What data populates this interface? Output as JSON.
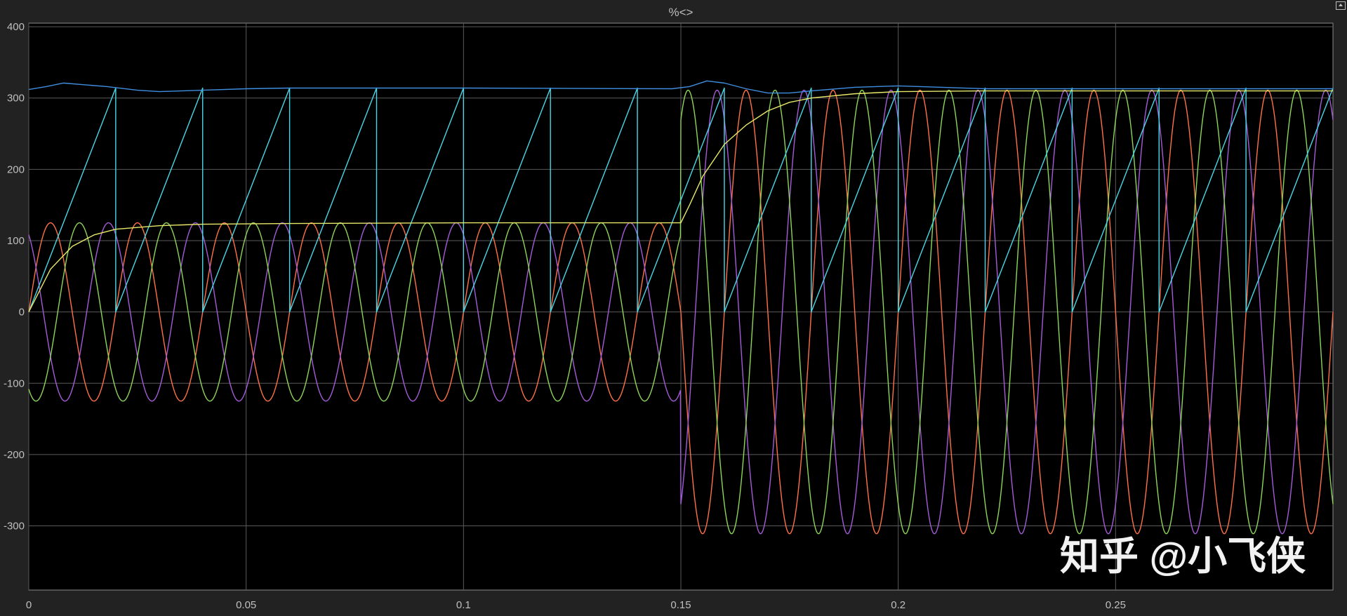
{
  "window": {
    "title": "%<>"
  },
  "watermark": "知乎 @小飞侠",
  "icons": {
    "undock": "undock-icon"
  },
  "chart_data": {
    "type": "line",
    "title": "%<>",
    "xlabel": "",
    "ylabel": "",
    "xlim": [
      0,
      0.3
    ],
    "ylim": [
      -390,
      405
    ],
    "grid": true,
    "background": "#000000",
    "x_ticks": [
      0,
      0.05,
      0.1,
      0.15,
      0.2,
      0.25
    ],
    "x_tick_labels": [
      "0",
      "0.05",
      "0.1",
      "0.15",
      "0.2",
      "0.25"
    ],
    "y_ticks": [
      400,
      300,
      200,
      100,
      0,
      -100,
      -200,
      -300
    ],
    "y_tick_labels": [
      "400",
      "300",
      "200",
      "100",
      "0",
      "-100",
      "-200",
      "-300"
    ],
    "series": [
      {
        "color": "#ff7148",
        "type": "sine",
        "frequency_hz": 50,
        "amplitude_segments": [
          {
            "x_start": 0,
            "x_end": 0.15,
            "amplitude": 125
          },
          {
            "x_start": 0.15,
            "x_end": 0.3,
            "amplitude": 311
          }
        ],
        "phase_deg": 0
      },
      {
        "color": "#a65bd9",
        "type": "sine",
        "frequency_hz": 50,
        "amplitude_segments": [
          {
            "x_start": 0,
            "x_end": 0.15,
            "amplitude": 125
          },
          {
            "x_start": 0.15,
            "x_end": 0.3,
            "amplitude": 311
          }
        ],
        "phase_deg": 120
      },
      {
        "color": "#8cd65a",
        "type": "sine",
        "frequency_hz": 50,
        "amplitude_segments": [
          {
            "x_start": 0,
            "x_end": 0.15,
            "amplitude": 125
          },
          {
            "x_start": 0.15,
            "x_end": 0.3,
            "amplitude": 311
          }
        ],
        "phase_deg": -120
      },
      {
        "color": "#48d8e8",
        "type": "sawtooth",
        "period": 0.02,
        "min": 0,
        "max": 314
      },
      {
        "color": "#e8e86a",
        "type": "points",
        "points": [
          [
            0,
            0
          ],
          [
            0.005,
            60
          ],
          [
            0.01,
            92
          ],
          [
            0.015,
            108
          ],
          [
            0.02,
            116
          ],
          [
            0.03,
            121
          ],
          [
            0.04,
            123
          ],
          [
            0.06,
            124
          ],
          [
            0.1,
            125
          ],
          [
            0.15,
            125
          ],
          [
            0.152,
            150
          ],
          [
            0.155,
            190
          ],
          [
            0.16,
            235
          ],
          [
            0.165,
            262
          ],
          [
            0.17,
            282
          ],
          [
            0.175,
            294
          ],
          [
            0.18,
            300
          ],
          [
            0.19,
            306
          ],
          [
            0.2,
            309
          ],
          [
            0.22,
            310
          ],
          [
            0.3,
            310
          ]
        ]
      },
      {
        "color": "#3f8ee0",
        "type": "points",
        "points": [
          [
            0,
            312
          ],
          [
            0.004,
            316
          ],
          [
            0.008,
            321
          ],
          [
            0.012,
            319
          ],
          [
            0.018,
            316
          ],
          [
            0.025,
            311
          ],
          [
            0.03,
            309
          ],
          [
            0.04,
            311
          ],
          [
            0.05,
            313
          ],
          [
            0.06,
            314
          ],
          [
            0.1,
            314
          ],
          [
            0.148,
            313
          ],
          [
            0.152,
            316
          ],
          [
            0.156,
            324
          ],
          [
            0.16,
            321
          ],
          [
            0.165,
            313
          ],
          [
            0.17,
            307
          ],
          [
            0.175,
            307
          ],
          [
            0.18,
            310
          ],
          [
            0.19,
            315
          ],
          [
            0.2,
            317
          ],
          [
            0.21,
            315
          ],
          [
            0.22,
            313
          ],
          [
            0.25,
            313
          ],
          [
            0.3,
            313
          ]
        ]
      }
    ]
  }
}
